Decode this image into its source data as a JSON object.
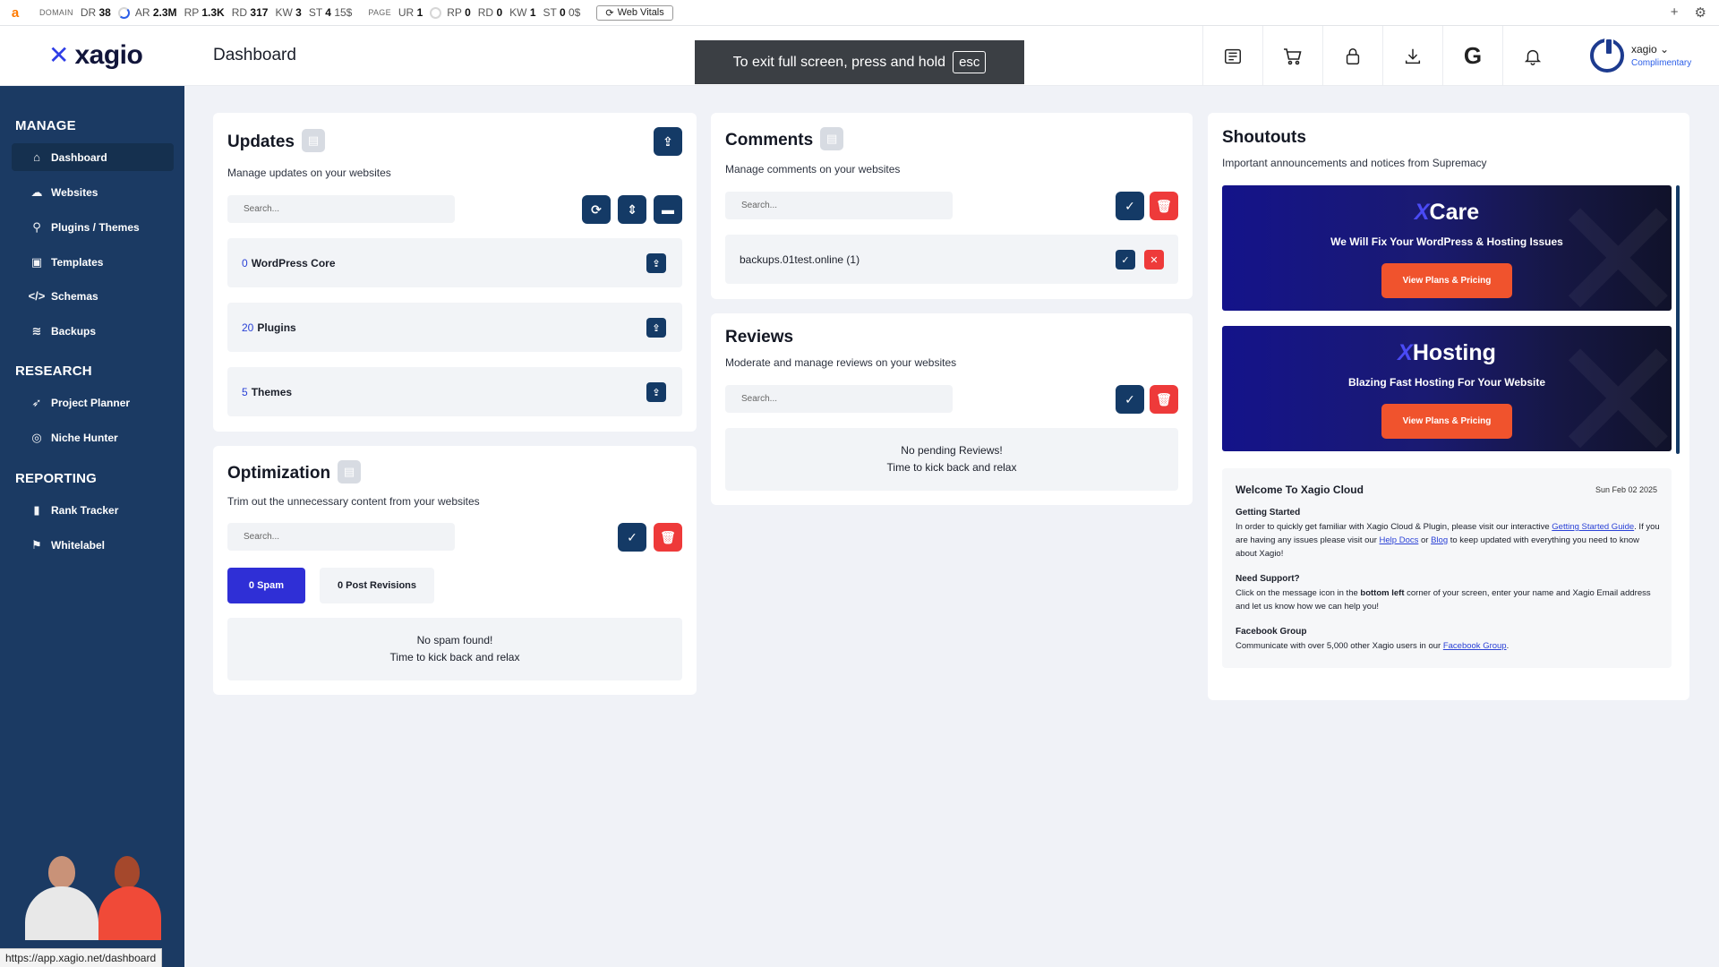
{
  "extbar": {
    "logo": "a",
    "domain_label": "DOMAIN",
    "domain_metrics": [
      {
        "k": "DR",
        "v": "38"
      },
      {
        "k": "AR",
        "v": "2.3M"
      },
      {
        "k": "RP",
        "v": "1.3K"
      },
      {
        "k": "RD",
        "v": "317"
      },
      {
        "k": "KW",
        "v": "3"
      },
      {
        "k": "ST",
        "v": "4"
      }
    ],
    "domain_st_extra": "15$",
    "page_label": "PAGE",
    "page_metrics": [
      {
        "k": "UR",
        "v": "1"
      },
      {
        "k": "RP",
        "v": "0"
      },
      {
        "k": "RD",
        "v": "0"
      },
      {
        "k": "KW",
        "v": "1"
      },
      {
        "k": "ST",
        "v": "0"
      }
    ],
    "page_st_extra": "0$",
    "web_vitals": "Web Vitals"
  },
  "header": {
    "brand": "xagio",
    "title": "Dashboard",
    "fullscreen_msg": "To exit full screen, press and hold",
    "fullscreen_key": "esc",
    "user_name": "xagio",
    "user_plan": "Complimentary"
  },
  "sidebar": {
    "manage": "MANAGE",
    "research": "RESEARCH",
    "reporting": "REPORTING",
    "items": {
      "dashboard": "Dashboard",
      "websites": "Websites",
      "plugins": "Plugins / Themes",
      "templates": "Templates",
      "schemas": "Schemas",
      "backups": "Backups",
      "planner": "Project Planner",
      "niche": "Niche Hunter",
      "rank": "Rank Tracker",
      "whitelabel": "Whitelabel"
    }
  },
  "statusbar": "https://app.xagio.net/dashboard",
  "updates": {
    "title": "Updates",
    "subtitle": "Manage updates on your websites",
    "search_placeholder": "Search...",
    "rows": [
      {
        "count": "0",
        "label": "WordPress Core"
      },
      {
        "count": "20",
        "label": "Plugins"
      },
      {
        "count": "5",
        "label": "Themes"
      }
    ]
  },
  "optimization": {
    "title": "Optimization",
    "subtitle": "Trim out the unnecessary content from your websites",
    "search_placeholder": "Search...",
    "tab_spam": "0 Spam",
    "tab_revisions": "0 Post Revisions",
    "empty_line1": "No spam found!",
    "empty_line2": "Time to kick back and relax"
  },
  "comments": {
    "title": "Comments",
    "subtitle": "Manage comments on your websites",
    "search_placeholder": "Search...",
    "row": "backups.01test.online (1)"
  },
  "reviews": {
    "title": "Reviews",
    "subtitle": "Moderate and manage reviews on your websites",
    "search_placeholder": "Search...",
    "empty_line1": "No pending Reviews!",
    "empty_line2": "Time to kick back and relax"
  },
  "shoutouts": {
    "title": "Shoutouts",
    "subtitle": "Important announcements and notices from Supremacy",
    "banners": [
      {
        "brand": "Care",
        "tagline": "We Will Fix Your WordPress & Hosting Issues",
        "cta": "View Plans & Pricing"
      },
      {
        "brand": "Hosting",
        "tagline": "Blazing Fast Hosting For Your Website",
        "cta": "View Plans & Pricing"
      }
    ],
    "welcome": {
      "title": "Welcome To Xagio Cloud",
      "date": "Sun Feb 02 2025",
      "gs_title": "Getting Started",
      "gs_text1": "In order to quickly get familiar with Xagio Cloud & Plugin, please visit our interactive ",
      "gs_link1": "Getting Started Guide",
      "gs_text2": ". If you are having any issues please visit our ",
      "gs_link2": "Help Docs",
      "gs_text3": " or ",
      "gs_link3": "Blog",
      "gs_text4": " to keep updated with everything you need to know about Xagio!",
      "ns_title": "Need Support?",
      "ns_text1": "Click on the message icon in the ",
      "ns_bold": "bottom left",
      "ns_text2": " corner of your screen, enter your name and Xagio Email address and let us know how we can help you!",
      "fb_title": "Facebook Group",
      "fb_text1": "Communicate with over 5,000 other Xagio users in our ",
      "fb_link": "Facebook Group",
      "fb_text2": "."
    }
  }
}
